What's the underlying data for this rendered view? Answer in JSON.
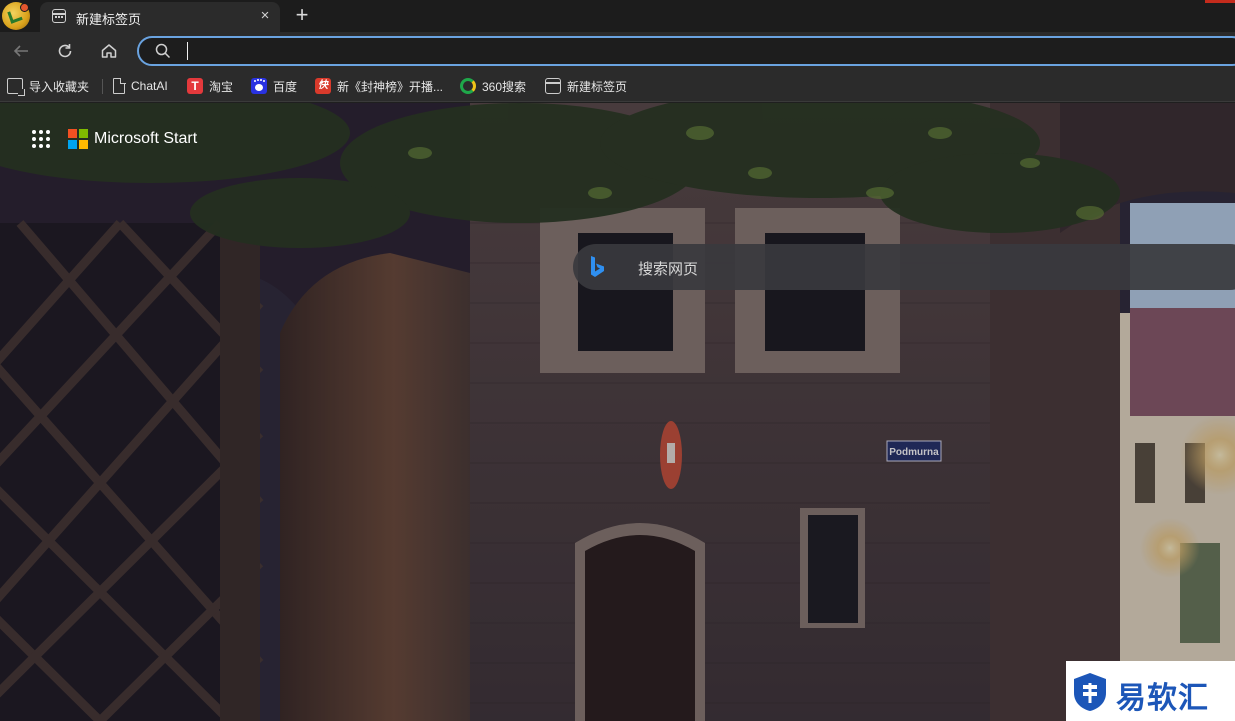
{
  "tabstrip": {
    "tab_title": "新建标签页",
    "close_glyph": "×",
    "new_tab_glyph": "+"
  },
  "navbar": {
    "back_glyph": "←",
    "reload_glyph": "↻",
    "home_glyph": "⌂",
    "address_value": ""
  },
  "bookmarks": [
    {
      "label": "导入收藏夹",
      "icon": "import-favorites-icon"
    },
    {
      "label": "ChatAI",
      "icon": "document-icon"
    },
    {
      "label": "淘宝",
      "icon": "taobao-icon"
    },
    {
      "label": "百度",
      "icon": "baidu-icon"
    },
    {
      "label": "新《封神榜》开播...",
      "icon": "kuaishou-icon"
    },
    {
      "label": "360搜索",
      "icon": "360-search-icon"
    },
    {
      "label": "新建标签页",
      "icon": "new-tab-page-icon"
    }
  ],
  "start_page": {
    "brand": "Microsoft Start",
    "search_placeholder": "搜索网页",
    "sign_text": "Podmurna"
  },
  "watermark": {
    "text": "易软汇"
  },
  "colors": {
    "accent_blue": "#6aa3e0",
    "ms_red": "#f25022",
    "ms_green": "#7fba00",
    "ms_blue": "#00a4ef",
    "ms_yellow": "#ffb900",
    "watermark_blue": "#1c56b8"
  }
}
